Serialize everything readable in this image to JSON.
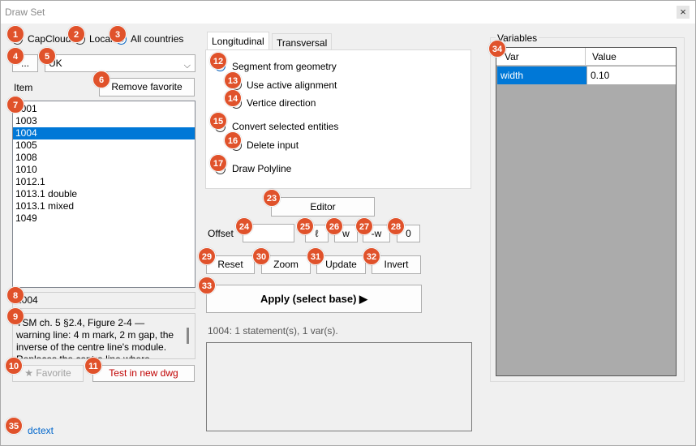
{
  "window": {
    "title": "Draw Set",
    "close_glyph": "×"
  },
  "source": {
    "options": [
      {
        "label": "CapCloud",
        "checked": false
      },
      {
        "label": "Local",
        "checked": false
      },
      {
        "label": "All countries",
        "checked": true
      }
    ]
  },
  "browse_button": "...",
  "country_select": {
    "value": "UK",
    "arrow": "⌵"
  },
  "item_label": "Item",
  "remove_favorite_button": "Remove favorite",
  "items": [
    "1001",
    "1003",
    "1004",
    "1005",
    "1008",
    "1010",
    "1012.1",
    "1013.1 double",
    "1013.1 mixed",
    "1049"
  ],
  "selected_item": "1004",
  "selected_item_field": "1004",
  "description": "TSM ch. 5 §2.4, Figure 2-4 — warning line: 4 m mark, 2 m gap, the inverse of the centre line's module. Replaces the centre line where forward",
  "favorite_button": "★ Favorite",
  "test_button": "Test in new dwg",
  "tabs": {
    "longitudinal": "Longitudinal",
    "transversal": "Transversal"
  },
  "options": {
    "segment_from_geometry": "Segment from geometry",
    "use_active_alignment": "Use active alignment",
    "vertice_direction": "Vertice direction",
    "convert_selected_entities": "Convert selected entities",
    "delete_input": "Delete input",
    "draw_polyline": "Draw Polyline"
  },
  "editor_button": "Editor",
  "offset": {
    "label": "Offset",
    "value": "",
    "buttons": [
      "ℓ",
      "w",
      "-w",
      "0"
    ]
  },
  "actions": {
    "reset": "Reset",
    "zoom": "Zoom",
    "update": "Update",
    "invert": "Invert"
  },
  "apply_button": "Apply (select base) ▶",
  "status": "1004: 1 statement(s), 1 var(s).",
  "variables": {
    "group_label": "Variables",
    "col_var": "Var",
    "col_value": "Value",
    "rows": [
      {
        "var": "width",
        "value": "0.10"
      }
    ]
  },
  "dctext_link": "dctext",
  "badges": [
    "1",
    "2",
    "3",
    "4",
    "5",
    "6",
    "7",
    "8",
    "9",
    "10",
    "11",
    "12",
    "13",
    "14",
    "15",
    "16",
    "17",
    "23",
    "24",
    "25",
    "26",
    "27",
    "28",
    "29",
    "30",
    "31",
    "32",
    "33",
    "34",
    "35"
  ],
  "colors": {
    "accent": "#0078d7",
    "badge": "#e0522b",
    "test_text": "#c00000",
    "link": "#0066cc"
  }
}
